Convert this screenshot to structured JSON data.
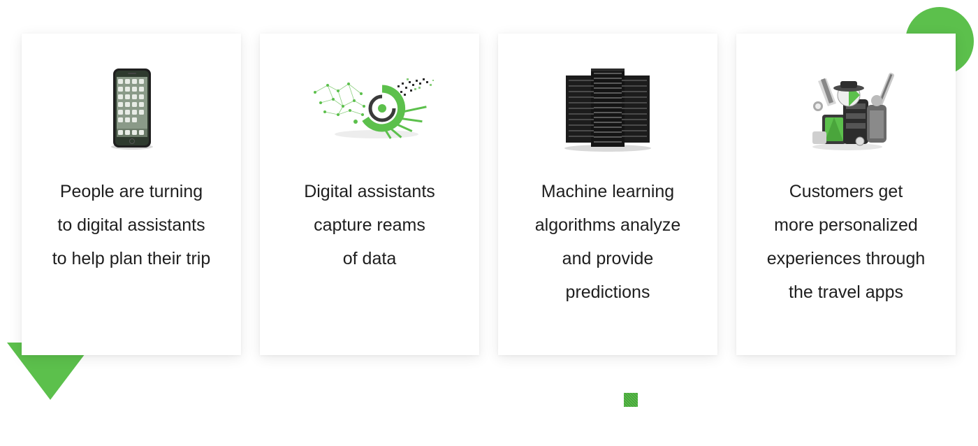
{
  "colors": {
    "accent": "#5cc04c",
    "text": "#1e1e1e",
    "card_background": "#ffffff"
  },
  "cards": [
    {
      "icon": "smartphone-illustration",
      "lines": [
        "People are turning",
        "to digital assistants",
        "to help plan their trip"
      ]
    },
    {
      "icon": "data-visualization-illustration",
      "lines": [
        "Digital assistants",
        "capture reams",
        "of data"
      ]
    },
    {
      "icon": "server-racks-illustration",
      "lines": [
        "Machine learning",
        "algorithms analyze",
        "and provide",
        "predictions"
      ]
    },
    {
      "icon": "travel-luggage-illustration",
      "lines": [
        "Customers get",
        "more personalized",
        "experiences through",
        "the travel apps"
      ]
    }
  ]
}
